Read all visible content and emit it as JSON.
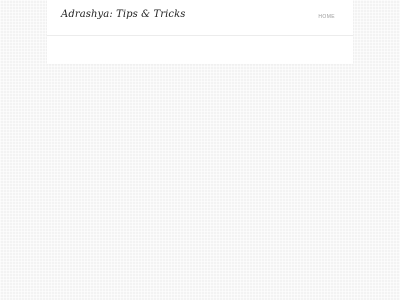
{
  "site": {
    "title": "Adrashya: Tips & Tricks"
  },
  "nav": {
    "menu_label": "Home"
  }
}
